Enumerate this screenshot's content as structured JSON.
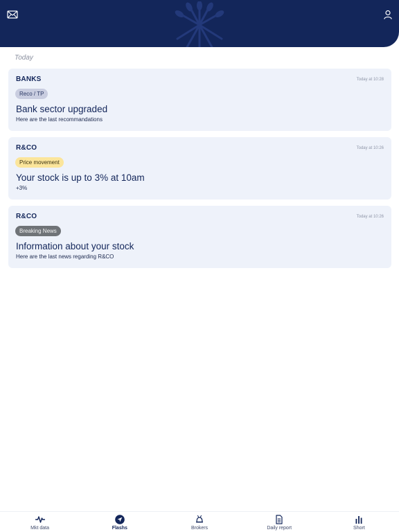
{
  "header": {
    "mail_icon": "envelope-icon",
    "logo": "wheat-sheaf-logo",
    "user_icon": "user-icon",
    "color": "#13265a"
  },
  "section": {
    "label": "Today"
  },
  "flashes": [
    {
      "company": "BANKS",
      "time": "Today at 10:28",
      "badge": "Reco / TP",
      "badge_color": "#c9cde0",
      "title": "Bank sector upgraded",
      "subtitle": "Here are the last recommandations"
    },
    {
      "company": "R&CO",
      "time": "Today at 10:26",
      "badge": "Price movement",
      "badge_color": "#fbe59b",
      "title": "Your stock is up to 3% at 10am",
      "subtitle": "+3%"
    },
    {
      "company": "R&CO",
      "time": "Today at 10:26",
      "badge": "Breaking News",
      "badge_color": "#6f7377",
      "title": "Information about your stock",
      "subtitle": "Here are the last news regarding R&CO"
    }
  ],
  "nav": {
    "active": "Flashs",
    "items": [
      {
        "label": "Mkt data",
        "icon": "pulse-icon"
      },
      {
        "label": "Flashs",
        "icon": "paper-plane-icon"
      },
      {
        "label": "Brokers",
        "icon": "bell-icon"
      },
      {
        "label": "Daily report",
        "icon": "document-icon"
      },
      {
        "label": "Short",
        "icon": "bar-chart-icon"
      }
    ]
  }
}
